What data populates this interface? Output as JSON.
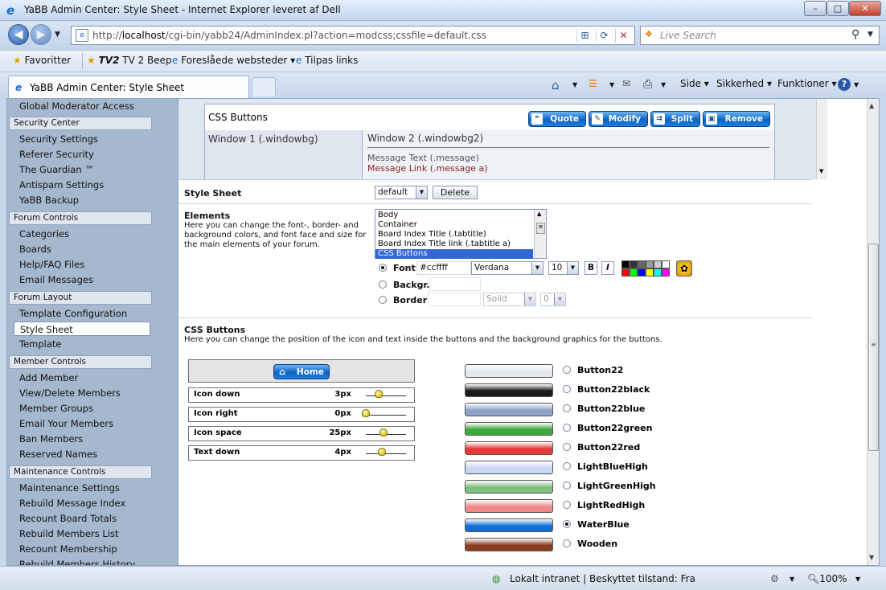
{
  "window": {
    "title": "YaBB Admin Center: Style Sheet - Internet Explorer leveret af Dell",
    "minimize": "–",
    "maximize": "□",
    "close": "✕"
  },
  "address": {
    "prefix": "http://",
    "host": "localhost",
    "path": "/cgi-bin/yabb24/AdminIndex.pl?action=modcss;cssfile=default.css",
    "search_placeholder": "Live Search"
  },
  "favorites": {
    "favoritter": "Favoritter",
    "tv2": "TV 2 Beep",
    "foreslaaede": "Foreslåede websteder ▾",
    "tilpas": "Tilpas links"
  },
  "tab": {
    "title": "YaBB Admin Center: Style Sheet"
  },
  "commands": {
    "side": "Side ▾",
    "sikkerhed": "Sikkerhed ▾",
    "funktioner": "Funktioner ▾"
  },
  "sidebar": {
    "top_item": "Global Moderator Access",
    "sections": [
      {
        "title": "Security Center",
        "items": [
          "Security Settings",
          "Referer Security",
          "The Guardian ™",
          "Antispam Settings",
          "YaBB Backup"
        ]
      },
      {
        "title": "Forum Controls",
        "items": [
          "Categories",
          "Boards",
          "Help/FAQ Files",
          "Email Messages"
        ]
      },
      {
        "title": "Forum Layout",
        "items": [
          "Template Configuration",
          "Style Sheet",
          "Template"
        ]
      },
      {
        "title": "Member Controls",
        "items": [
          "Add Member",
          "View/Delete Members",
          "Member Groups",
          "Email Your Members",
          "Ban Members",
          "Reserved Names"
        ]
      },
      {
        "title": "Maintenance Controls",
        "items": [
          "Maintenance Settings",
          "Rebuild Message Index",
          "Recount Board Totals",
          "Rebuild Members List",
          "Recount Membership",
          "Rebuild Members History"
        ]
      }
    ]
  },
  "preview": {
    "css_buttons_label": "CSS Buttons",
    "buttons": [
      "Quote",
      "Modify",
      "Split",
      "Remove"
    ],
    "window1": "Window 1 (.windowbg)",
    "window2": "Window 2 (.windowbg2)",
    "message_text": "Message Text (.message)",
    "message_link": "Message Link (.message a)"
  },
  "stylesheet": {
    "label": "Style Sheet",
    "selected": "default",
    "delete_label": "Delete"
  },
  "elements": {
    "label": "Elements",
    "description": "Here you can change the font-, border- and background colors, and font face and size for the main elements of your forum.",
    "list": [
      "Body",
      "Container",
      "Board Index Title (.tabtitle)",
      "Board Index Title link (.tabtitle a)",
      "CSS Buttons"
    ],
    "font_label": "Font",
    "font_color": "#ccffff",
    "font_face": "Verdana",
    "font_size": "10",
    "bold": "B",
    "italic": "I",
    "backgr_label": "Backgr.",
    "border_label": "Border",
    "border_style": "Solid",
    "border_width": "0",
    "palette": [
      "#000000",
      "#333333",
      "#666666",
      "#999999",
      "#cccccc",
      "#ffffff",
      "#ff0000",
      "#00ff00",
      "#0000ff",
      "#ffff00",
      "#00ffff",
      "#ff00ff"
    ]
  },
  "css_buttons": {
    "label": "CSS Buttons",
    "description": "Here you can change the position of the icon and text inside the buttons and the background graphics for the buttons.",
    "home_label": "Home",
    "sliders": [
      {
        "label": "Icon down",
        "value": "3px",
        "level": 0.36
      },
      {
        "label": "Icon right",
        "value": "0px",
        "level": 0.0
      },
      {
        "label": "Icon space",
        "value": "25px",
        "level": 0.5
      },
      {
        "label": "Text down",
        "value": "4px",
        "level": 0.46
      }
    ],
    "backgrounds": [
      {
        "name": "Button22",
        "color": "#e6e8ef",
        "selected": false
      },
      {
        "name": "Button22black",
        "color": "#1a1a1a",
        "selected": false
      },
      {
        "name": "Button22blue",
        "color": "#8ea3c6",
        "selected": false
      },
      {
        "name": "Button22green",
        "color": "#3ea83e",
        "selected": false
      },
      {
        "name": "Button22red",
        "color": "#e43a3a",
        "selected": false
      },
      {
        "name": "LightBlueHigh",
        "color": "#c7d6f5",
        "selected": false
      },
      {
        "name": "LightGreenHigh",
        "color": "#7fc07f",
        "selected": false
      },
      {
        "name": "LightRedHigh",
        "color": "#ef8a8a",
        "selected": false
      },
      {
        "name": "WaterBlue",
        "color": "#0f6fd8",
        "selected": true
      },
      {
        "name": "Wooden",
        "color": "#8b3d1f",
        "selected": false
      }
    ]
  },
  "statusbar": {
    "zone": "Lokalt intranet | Beskyttet tilstand: Fra",
    "zoom": "100%"
  }
}
